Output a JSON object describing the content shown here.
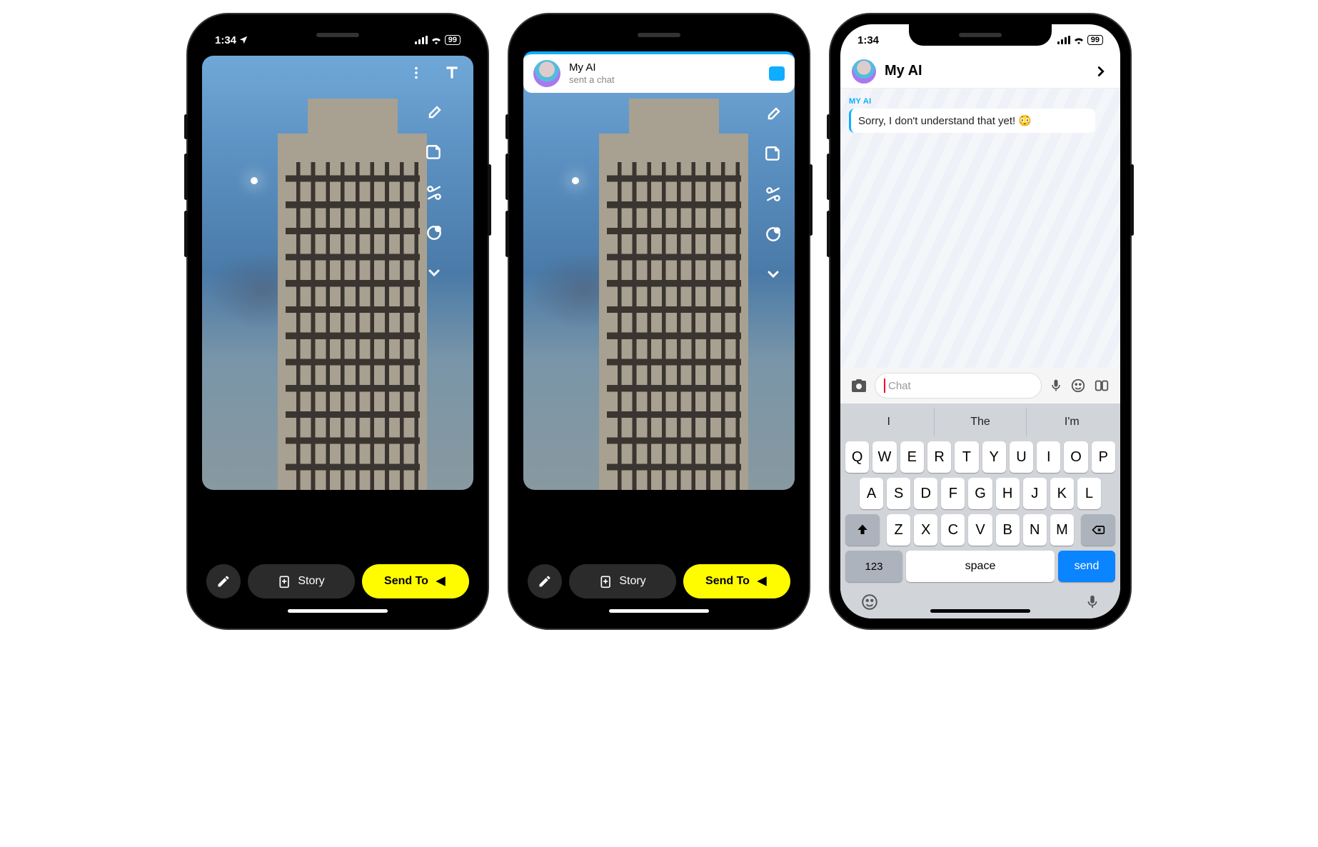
{
  "status": {
    "time": "1:34",
    "battery": "99"
  },
  "editor": {
    "story_label": "Story",
    "send_label": "Send To",
    "tools": {
      "more": "more-options",
      "text": "text",
      "attach": "link-attachment",
      "sticker": "sticker",
      "crop": "scissors-crop",
      "timer": "timer",
      "expand": "expand"
    }
  },
  "notification": {
    "title": "My AI",
    "subtitle": "sent a chat"
  },
  "chat": {
    "title": "My AI",
    "sender_label": "MY AI",
    "message": "Sorry, I don't understand that yet! 😳",
    "input_placeholder": "Chat"
  },
  "keyboard": {
    "suggestions": [
      "I",
      "The",
      "I'm"
    ],
    "row1": [
      "Q",
      "W",
      "E",
      "R",
      "T",
      "Y",
      "U",
      "I",
      "O",
      "P"
    ],
    "row2": [
      "A",
      "S",
      "D",
      "F",
      "G",
      "H",
      "J",
      "K",
      "L"
    ],
    "row3": [
      "Z",
      "X",
      "C",
      "V",
      "B",
      "N",
      "M"
    ],
    "numeric_label": "123",
    "space_label": "space",
    "send_label": "send"
  }
}
